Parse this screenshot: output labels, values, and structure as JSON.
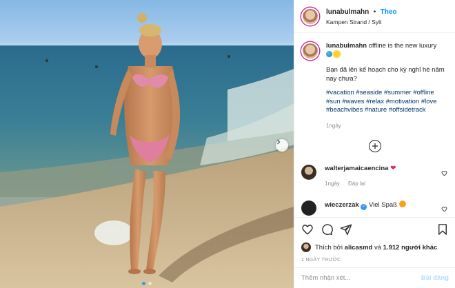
{
  "post": {
    "username": "lunabulmahn",
    "separator": "•",
    "follow_label": "Theo",
    "location": "Kampen Strand / Sylt"
  },
  "caption": {
    "username": "lunabulmahn",
    "first_line": "offline is the new luxury",
    "emoji_icons": [
      "globe-emoji-icon",
      "sun-emoji-icon"
    ],
    "paragraph": "Bạn đã lên kế hoạch cho kỳ nghỉ hè năm nay chưa?",
    "hashtags": "#vacation #seaside #summer #offline #sun #waves #relax #motivation #love #beachvibes #nature #offsidetrack",
    "time": "1ngày"
  },
  "comments": [
    {
      "username": "walterjamaicaencina",
      "text": "",
      "time": "1ngày",
      "reply_label": "Đáp lại"
    },
    {
      "username": "wieczerzak",
      "text": "Viel Spaß"
    }
  ],
  "likes": {
    "prefix": "Thích bởi",
    "user": "alicasmd",
    "middle": "và",
    "count": "1.912 người khác"
  },
  "date": "1 NGÀY TRƯỚC",
  "add_comment": {
    "placeholder": "Thêm nhận xét...",
    "post_label": "Bài đăng"
  },
  "carousel": {
    "total": 2,
    "active": 1
  },
  "colors": {
    "accent": "#0095f6",
    "hashtag": "#00376b",
    "muted": "#8e8e8e",
    "heart": "#e0245e"
  }
}
